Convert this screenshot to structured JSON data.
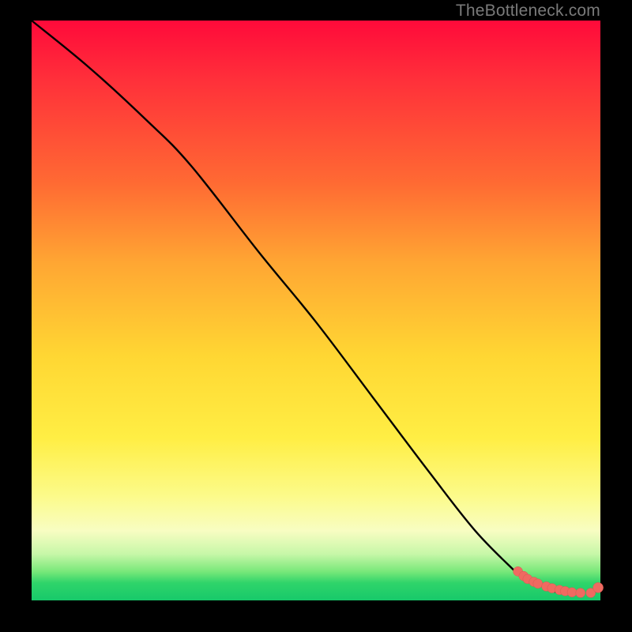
{
  "watermark": "TheBottleneck.com",
  "colors": {
    "curve": "#000000",
    "dots": "#ef6a61",
    "dot_stroke": "#d65a52"
  },
  "chart_data": {
    "type": "line",
    "title": "",
    "xlabel": "",
    "ylabel": "",
    "xlim": [
      0,
      100
    ],
    "ylim": [
      0,
      100
    ],
    "series": [
      {
        "name": "bottleneck-curve",
        "x": [
          0,
          10,
          20,
          28,
          40,
          50,
          60,
          70,
          78,
          85,
          88,
          90,
          92,
          94,
          96,
          98,
          100
        ],
        "y": [
          100,
          92,
          83,
          75,
          60,
          48,
          35,
          22,
          12,
          5,
          3,
          2,
          1.5,
          1.2,
          1,
          1,
          2
        ]
      }
    ],
    "dotted_segment_x_start": 85,
    "scatter": {
      "name": "highlight-dots",
      "x": [
        85.5,
        86.5,
        87.2,
        88.3,
        89.0,
        90.5,
        91.5,
        92.8,
        93.8,
        95.0,
        96.5,
        98.3,
        99.6
      ],
      "y": [
        5.0,
        4.2,
        3.7,
        3.2,
        2.9,
        2.4,
        2.1,
        1.8,
        1.6,
        1.4,
        1.3,
        1.3,
        2.2
      ]
    }
  }
}
